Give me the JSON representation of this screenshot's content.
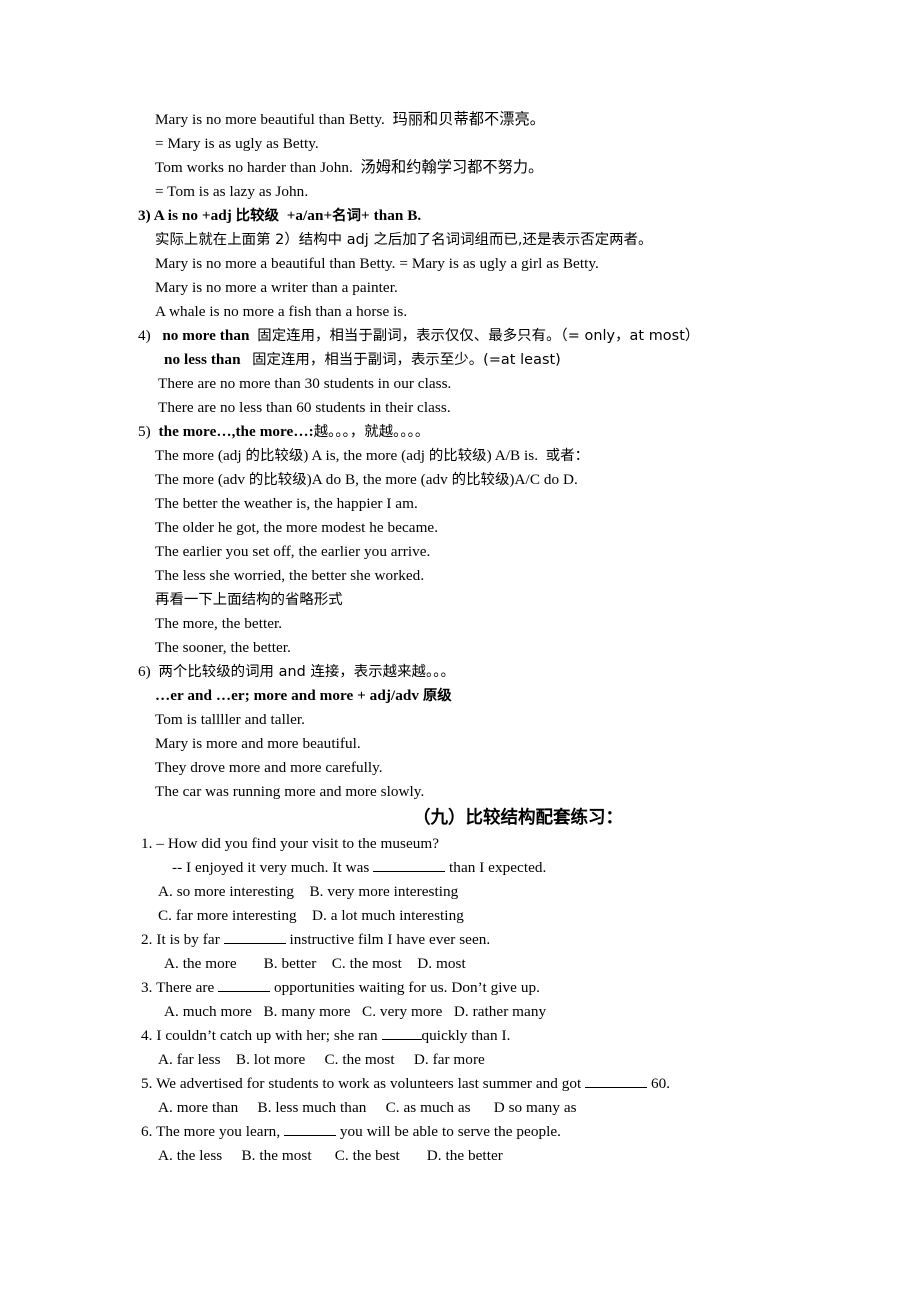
{
  "document": {
    "type": "grammar-worksheet",
    "language": "zh-CN/en",
    "lines": {
      "l1": "Mary is no more beautiful than Betty.  玛丽和贝蒂都不漂亮。",
      "l2": "= Mary is as ugly as Betty.",
      "l3": "Tom works no harder than John.  汤姆和约翰学习都不努力。",
      "l4": "= Tom is as lazy as John."
    },
    "item3": {
      "number": "3)",
      "title_en_1": "A is no +adj ",
      "title_cn": "比较级",
      "title_en_2": "  +a/an+",
      "title_cn2": "名词",
      "title_en_3": "+ than B.",
      "desc_cn": "实际上就在上面第 2）结构中 adj 之后加了名词词组而已,还是表示否定两者。",
      "ex1": "Mary is no more a beautiful than Betty. = Mary is as ugly a girl as Betty.",
      "ex2": "Mary is no more a writer than a painter.",
      "ex3": "A whale is no more a fish than a horse is."
    },
    "item4": {
      "number": "4)",
      "term1": "no more than",
      "term1_desc": "固定连用，相当于副词，表示仅仅、最多只有。（= only，at most）",
      "term2": "no less than",
      "term2_desc": "固定连用，相当于副词，表示至少。(=at least)",
      "ex1": "There are no more than 30 students in our class.",
      "ex2": "There are no less than 60 students in their class."
    },
    "item5": {
      "number": "5)",
      "term": "the more…,the more…:",
      "term_cn": "越。。。，就越。。。。",
      "pattern1_a": "The more (adj ",
      "pattern1_cn1": "的比较级",
      "pattern1_b": ") A is, the more (adj ",
      "pattern1_cn2": "的比较级",
      "pattern1_c": ") A/B is.  ",
      "pattern1_cn3": "或者：",
      "pattern2_a": "The more (adv ",
      "pattern2_cn1": "的比较级",
      "pattern2_b": ")A do B, the more (adv ",
      "pattern2_cn2": "的比较级",
      "pattern2_c": ")A/C do D.",
      "ex1": "The better the weather is, the happier I am.",
      "ex2": "The older he got, the more modest he became.",
      "ex3": "The earlier you set off, the earlier you arrive.",
      "ex4": "The less she worried, the better she worked.",
      "note_cn": "再看一下上面结构的省略形式",
      "ex5": "The more, the better.",
      "ex6": "The sooner, the better."
    },
    "item6": {
      "number": "6)",
      "desc_cn_a": "两个比较级的词用 and ",
      "desc_cn_b": "连接，表示越来越。。。",
      "formula_en": "…er and …er; more and more + adj/adv ",
      "formula_cn": "原级",
      "ex1": "Tom is tallller and taller.",
      "ex2": "Mary is more and more beautiful.",
      "ex3": "They drove more and more carefully.",
      "ex4": "The car was running more and more slowly."
    },
    "exercise_heading": "（九）比较结构配套练习：",
    "exercises": [
      {
        "number": "1.",
        "prompt": "– How did you find your visit to the museum?",
        "prompt2_pre": "-- I enjoyed it very much. It was ",
        "prompt2_post": " than I expected.",
        "blank_size": "bl-l",
        "options_row1": "A. so more interesting    B. very more interesting",
        "options_row2": "C. far more interesting    D. a lot much interesting"
      },
      {
        "number": "2.",
        "stem_pre": "It is by far ",
        "stem_post": " instructive film I have ever seen.",
        "blank_size": "bl-m",
        "options_row1": "A. the more       B. better    C. the most    D. most"
      },
      {
        "number": "3.",
        "stem_pre": "There are ",
        "stem_post": " opportunities waiting for us. Don’t give up.",
        "blank_size": "bl-s",
        "options_row1": "A. much more   B. many more   C. very more   D. rather many"
      },
      {
        "number": "4.",
        "stem_pre": "I couldn’t catch up with her; she ran ",
        "stem_post": "quickly than I.",
        "blank_size": "bl-xs",
        "options_row1": "A. far less    B. lot more     C. the most     D. far more"
      },
      {
        "number": "5.",
        "stem_pre": "We advertised for students to work as volunteers last summer and got ",
        "stem_post": " 60.",
        "blank_size": "bl-m",
        "options_row1": "A. more than     B. less much than     C. as much as      D so many as"
      },
      {
        "number": "6.",
        "stem_pre": "The more you learn, ",
        "stem_post": " you will be able to serve the people.",
        "blank_size": "bl-s",
        "options_row1": "A. the less     B. the most      C. the best       D. the better"
      }
    ]
  }
}
